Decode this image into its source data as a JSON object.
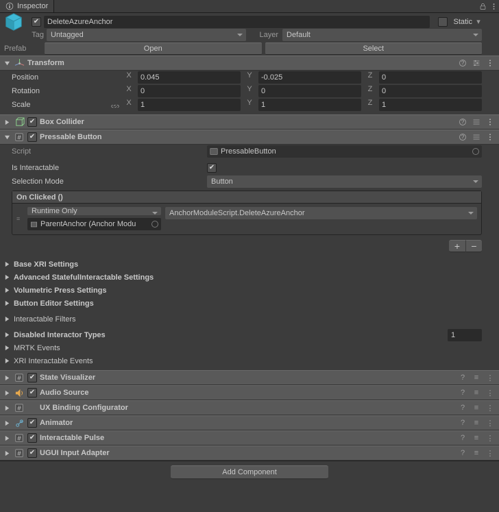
{
  "tab": {
    "title": "Inspector"
  },
  "header": {
    "name": "DeleteAzureAnchor",
    "static_label": "Static",
    "tag_label": "Tag",
    "tag_value": "Untagged",
    "layer_label": "Layer",
    "layer_value": "Default",
    "prefab_label": "Prefab",
    "open_btn": "Open",
    "select_btn": "Select"
  },
  "transform": {
    "title": "Transform",
    "position": {
      "label": "Position",
      "x": "0.045",
      "y": "-0.025",
      "z": "0"
    },
    "rotation": {
      "label": "Rotation",
      "x": "0",
      "y": "0",
      "z": "0"
    },
    "scale": {
      "label": "Scale",
      "x": "1",
      "y": "1",
      "z": "1"
    }
  },
  "box_collider": {
    "title": "Box Collider"
  },
  "pressable": {
    "title": "Pressable Button",
    "script_label": "Script",
    "script_value": "PressableButton",
    "is_interactable_label": "Is Interactable",
    "selection_mode_label": "Selection Mode",
    "selection_mode_value": "Button",
    "event_header": "On Clicked ()",
    "runtime_value": "Runtime Only",
    "method_value": "AnchorModuleScript.DeleteAzureAnchor",
    "object_value": "ParentAnchor (Anchor Modu"
  },
  "sections": {
    "base_xri": "Base XRI Settings",
    "adv_stateful": "Advanced StatefulInteractable Settings",
    "vol_press": "Volumetric Press Settings",
    "btn_editor": "Button Editor Settings",
    "interactable_filters": "Interactable Filters",
    "disabled_interactor": {
      "label": "Disabled Interactor Types",
      "value": "1"
    },
    "mrtk_events": "MRTK Events",
    "xri_events": "XRI Interactable Events"
  },
  "components": {
    "state_visualizer": "State Visualizer",
    "audio_source": "Audio Source",
    "ux_binding": "UX Binding Configurator",
    "animator": "Animator",
    "interactable_pulse": "Interactable Pulse",
    "ugui_input": "UGUI Input Adapter"
  },
  "footer": {
    "add_component": "Add Component"
  }
}
